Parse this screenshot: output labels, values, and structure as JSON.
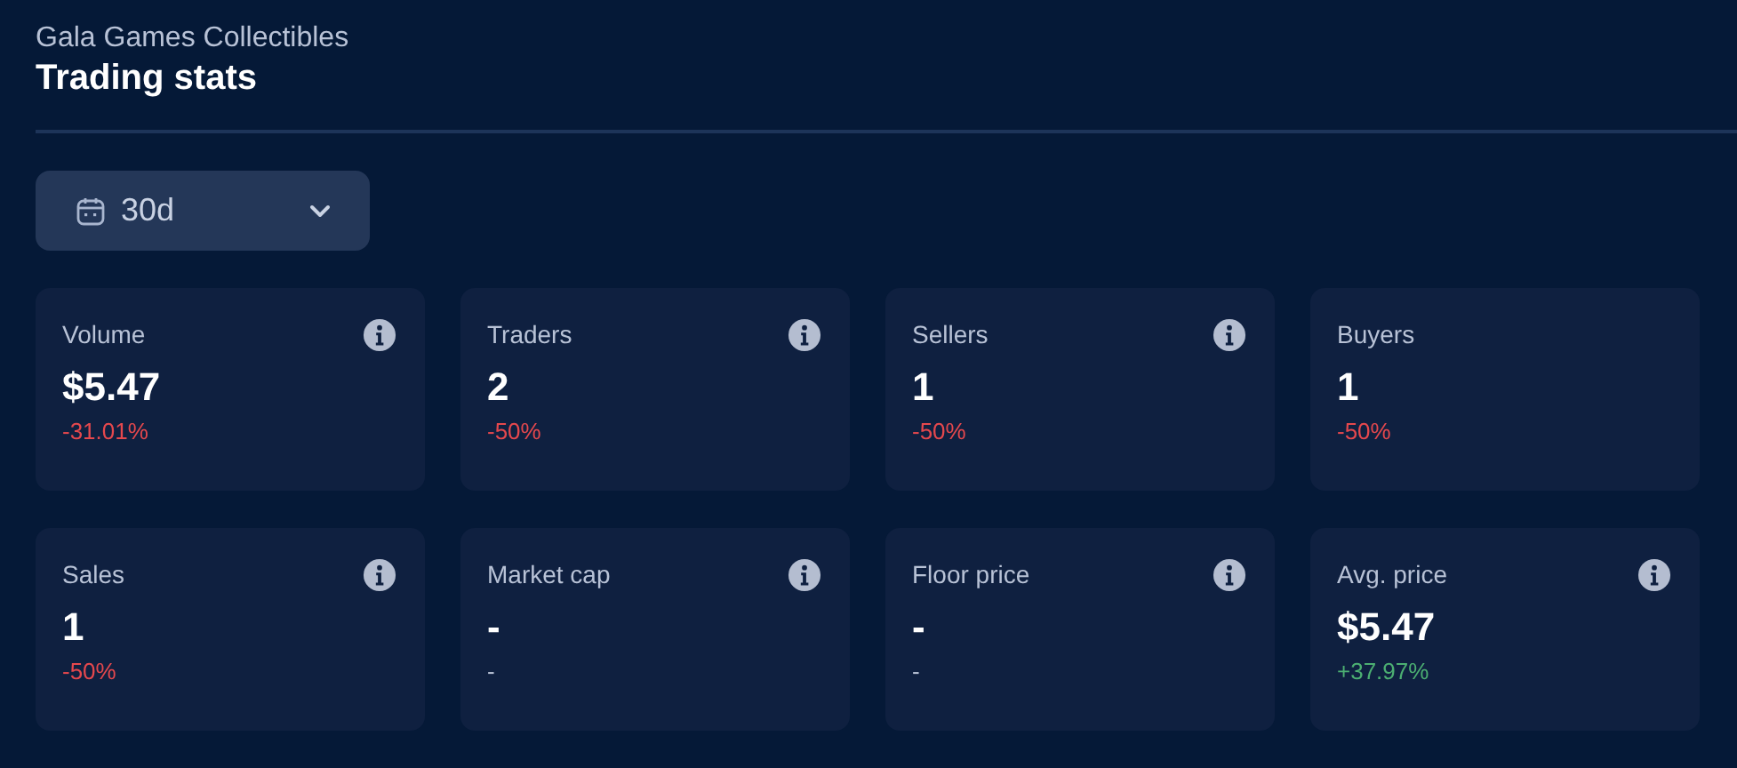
{
  "header": {
    "subtitle": "Gala Games Collectibles",
    "title": "Trading stats"
  },
  "period": {
    "value": "30d"
  },
  "stats": [
    {
      "label": "Volume",
      "value": "$5.47",
      "change": "-31.01%",
      "color": "#e5484d",
      "info": true
    },
    {
      "label": "Traders",
      "value": "2",
      "change": "-50%",
      "color": "#e5484d",
      "info": true
    },
    {
      "label": "Sellers",
      "value": "1",
      "change": "-50%",
      "color": "#e5484d",
      "info": true
    },
    {
      "label": "Buyers",
      "value": "1",
      "change": "-50%",
      "color": "#e5484d",
      "info": false
    },
    {
      "label": "Sales",
      "value": "1",
      "change": "-50%",
      "color": "#e5484d",
      "info": true
    },
    {
      "label": "Market cap",
      "value": "-",
      "change": "-",
      "color": "#b8c2d6",
      "info": true
    },
    {
      "label": "Floor price",
      "value": "-",
      "change": "-",
      "color": "#b8c2d6",
      "info": true
    },
    {
      "label": "Avg. price",
      "value": "$5.47",
      "change": "+37.97%",
      "color": "#4caf72",
      "info": true
    }
  ]
}
